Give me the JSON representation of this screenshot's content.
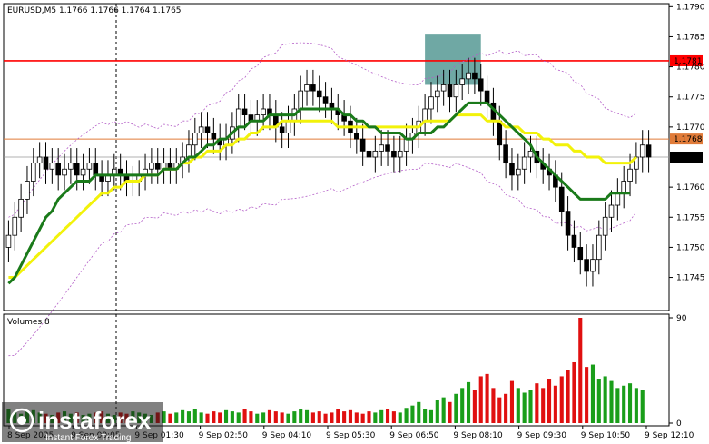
{
  "header": {
    "symbol_line": "EURUSD,M5  1.1766 1.1766 1.1764 1.1765",
    "volumes_label": "Volumes 8"
  },
  "watermark": {
    "brand": "instaforex",
    "tagline": "Instant Forex Trading"
  },
  "levels": {
    "resistance": {
      "label": "1.1781",
      "value": 1.1781,
      "color": "#ff0000"
    },
    "mid": {
      "label": "1.1768",
      "value": 1.1768,
      "color": "#e07b39"
    },
    "current": {
      "label": "1.1765",
      "value": 1.1765
    }
  },
  "chart_data": [
    {
      "type": "candlestick",
      "title": "EURUSD,M5  1.1766 1.1766 1.1764 1.1765",
      "ylim": [
        1.17395,
        1.17905
      ],
      "y_ticks": [
        "1.1790",
        "1.1785",
        "1.1780",
        "1.1775",
        "1.1770",
        "1.1760",
        "1.1755",
        "1.1750",
        "1.1745"
      ],
      "y_tick_values": [
        1.179,
        1.1785,
        1.178,
        1.1775,
        1.177,
        1.176,
        1.1755,
        1.175,
        1.1745
      ],
      "x_ticks": [
        "8 Sep 2025",
        "9 Sep 00:05",
        "9 Sep 01:30",
        "9 Sep 02:50",
        "9 Sep 04:10",
        "9 Sep 05:30",
        "9 Sep 06:50",
        "9 Sep 08:10",
        "9 Sep 09:30",
        "9 Sep 10:50",
        "9 Sep 12:10"
      ],
      "close": [
        1.1752,
        1.1755,
        1.1758,
        1.1761,
        1.1764,
        1.1765,
        1.1763,
        1.1764,
        1.1762,
        1.1763,
        1.1764,
        1.1762,
        1.1763,
        1.1764,
        1.1762,
        1.1761,
        1.1762,
        1.1763,
        1.1762,
        1.1761,
        1.1761,
        1.1762,
        1.1763,
        1.1764,
        1.1763,
        1.1764,
        1.1763,
        1.1764,
        1.1765,
        1.1767,
        1.1769,
        1.177,
        1.1769,
        1.1768,
        1.1767,
        1.1768,
        1.177,
        1.1773,
        1.1772,
        1.1771,
        1.1772,
        1.1773,
        1.1772,
        1.177,
        1.1769,
        1.1771,
        1.1773,
        1.1776,
        1.1777,
        1.1776,
        1.1775,
        1.1774,
        1.1773,
        1.1772,
        1.1771,
        1.1769,
        1.1768,
        1.1766,
        1.1765,
        1.1766,
        1.1767,
        1.1766,
        1.1765,
        1.1766,
        1.1768,
        1.1769,
        1.1771,
        1.1773,
        1.1775,
        1.1776,
        1.1777,
        1.1775,
        1.1777,
        1.1778,
        1.1779,
        1.1778,
        1.1776,
        1.1774,
        1.1771,
        1.1767,
        1.1764,
        1.1762,
        1.1763,
        1.1765,
        1.1766,
        1.1764,
        1.1763,
        1.1762,
        1.176,
        1.1756,
        1.1752,
        1.175,
        1.1748,
        1.1746,
        1.1748,
        1.1752,
        1.1755,
        1.1757,
        1.1759,
        1.1761,
        1.1763,
        1.1765,
        1.1767,
        1.1765
      ],
      "ma_green": [
        1.1744,
        1.1745,
        1.1747,
        1.1749,
        1.1751,
        1.1753,
        1.1755,
        1.1756,
        1.1758,
        1.1759,
        1.176,
        1.1761,
        1.1761,
        1.1761,
        1.1762,
        1.1762,
        1.1762,
        1.1762,
        1.1762,
        1.1762,
        1.1762,
        1.1762,
        1.1762,
        1.1762,
        1.1762,
        1.1763,
        1.1763,
        1.1763,
        1.1764,
        1.1765,
        1.1765,
        1.1766,
        1.1767,
        1.1767,
        1.1768,
        1.1768,
        1.1769,
        1.177,
        1.177,
        1.1771,
        1.1771,
        1.1771,
        1.1772,
        1.1772,
        1.1772,
        1.1772,
        1.1772,
        1.1773,
        1.1773,
        1.1773,
        1.1773,
        1.1773,
        1.1773,
        1.1773,
        1.1772,
        1.1772,
        1.1771,
        1.1771,
        1.177,
        1.177,
        1.1769,
        1.1769,
        1.1769,
        1.1769,
        1.1768,
        1.1768,
        1.1769,
        1.1769,
        1.1769,
        1.177,
        1.177,
        1.1771,
        1.1772,
        1.1773,
        1.1774,
        1.1774,
        1.1774,
        1.1774,
        1.1773,
        1.1772,
        1.1771,
        1.177,
        1.1769,
        1.1768,
        1.1767,
        1.1765,
        1.1764,
        1.1763,
        1.1762,
        1.1761,
        1.176,
        1.1759,
        1.1758,
        1.1758,
        1.1758,
        1.1758,
        1.1758,
        1.1759,
        1.1759,
        1.1759,
        1.1759
      ],
      "ma_yellow": [
        1.1745,
        1.1745,
        1.1746,
        1.1747,
        1.1748,
        1.1749,
        1.175,
        1.1751,
        1.1752,
        1.1753,
        1.1754,
        1.1755,
        1.1756,
        1.1757,
        1.1758,
        1.1759,
        1.1759,
        1.176,
        1.176,
        1.1761,
        1.1761,
        1.1761,
        1.1762,
        1.1762,
        1.1762,
        1.1763,
        1.1763,
        1.1763,
        1.1764,
        1.1764,
        1.1765,
        1.1765,
        1.1766,
        1.1766,
        1.1766,
        1.1767,
        1.1767,
        1.1768,
        1.1768,
        1.1769,
        1.1769,
        1.177,
        1.177,
        1.177,
        1.1771,
        1.1771,
        1.1771,
        1.1771,
        1.1771,
        1.1771,
        1.1771,
        1.1771,
        1.1771,
        1.177,
        1.177,
        1.177,
        1.177,
        1.177,
        1.177,
        1.177,
        1.177,
        1.177,
        1.177,
        1.177,
        1.177,
        1.177,
        1.177,
        1.1771,
        1.1771,
        1.1771,
        1.1771,
        1.1771,
        1.1772,
        1.1772,
        1.1772,
        1.1772,
        1.1772,
        1.1771,
        1.1771,
        1.1771,
        1.177,
        1.177,
        1.177,
        1.1769,
        1.1769,
        1.1769,
        1.1768,
        1.1768,
        1.1767,
        1.1767,
        1.1767,
        1.1766,
        1.1766,
        1.1765,
        1.1765,
        1.1765,
        1.1764,
        1.1764,
        1.1764,
        1.1764,
        1.1764,
        1.1765
      ],
      "highlight_zone": {
        "x_from": "9 Sep 08:10",
        "price_from": 1.1777,
        "price_to": 1.17855,
        "color": "#5f9e9a"
      }
    },
    {
      "type": "bar",
      "title": "Volumes 8",
      "ylim": [
        0,
        90
      ],
      "y_ticks": [
        "90",
        "0"
      ],
      "y_tick_values": [
        90,
        0
      ],
      "values": [
        12,
        9,
        8,
        10,
        11,
        9,
        8,
        7,
        9,
        10,
        8,
        9,
        7,
        8,
        9,
        10,
        8,
        7,
        9,
        8,
        10,
        9,
        8,
        7,
        9,
        10,
        8,
        9,
        11,
        10,
        12,
        9,
        8,
        10,
        9,
        11,
        10,
        9,
        12,
        10,
        8,
        9,
        11,
        10,
        9,
        8,
        10,
        12,
        11,
        9,
        10,
        8,
        9,
        12,
        10,
        11,
        9,
        8,
        10,
        9,
        11,
        12,
        10,
        9,
        13,
        15,
        18,
        12,
        11,
        20,
        22,
        18,
        25,
        30,
        35,
        28,
        40,
        42,
        30,
        22,
        25,
        36,
        30,
        26,
        28,
        34,
        30,
        38,
        32,
        40,
        45,
        52,
        90,
        48,
        50,
        38,
        40,
        36,
        30,
        32,
        34,
        30,
        28
      ]
    }
  ]
}
